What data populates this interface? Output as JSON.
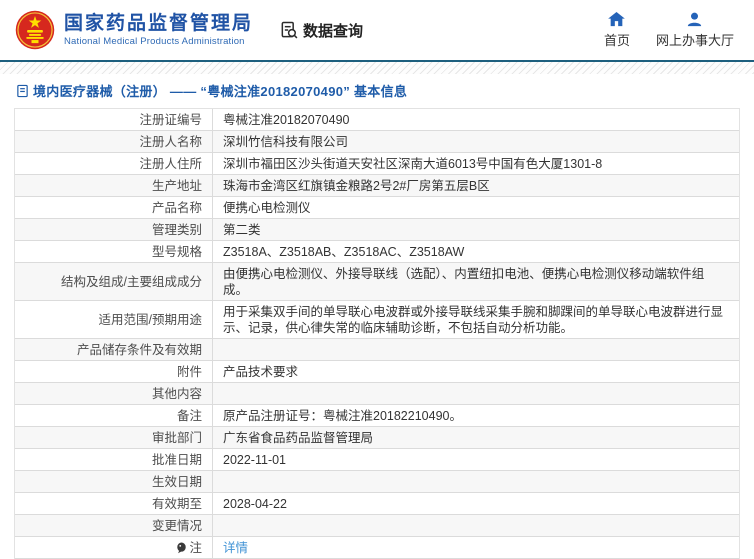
{
  "header": {
    "agency_name_zh": "国家药品监督管理局",
    "agency_name_en": "National Medical Products Administration",
    "nav_data_query": "数据查询",
    "nav_home": "首页",
    "nav_service_hall": "网上办事大厅"
  },
  "breadcrumb": {
    "title": "境内医疗器械（注册） —— “粤械注准20182070490” 基本信息"
  },
  "table": {
    "rows": [
      {
        "label": "注册证编号",
        "value": "粤械注准20182070490"
      },
      {
        "label": "注册人名称",
        "value": "深圳竹信科技有限公司"
      },
      {
        "label": "注册人住所",
        "value": "深圳市福田区沙头街道天安社区深南大道6013号中国有色大厦1301-8"
      },
      {
        "label": "生产地址",
        "value": "珠海市金湾区红旗镇金粮路2号2#厂房第五层B区"
      },
      {
        "label": "产品名称",
        "value": "便携心电检测仪"
      },
      {
        "label": "管理类别",
        "value": "第二类"
      },
      {
        "label": "型号规格",
        "value": "Z3518A、Z3518AB、Z3518AC、Z3518AW"
      },
      {
        "label": "结构及组成/主要组成成分",
        "value": "由便携心电检测仪、外接导联线（选配）、内置纽扣电池、便携心电检测仪移动端软件组成。"
      },
      {
        "label": "适用范围/预期用途",
        "value": "用于采集双手间的单导联心电波群或外接导联线采集手腕和脚踝间的单导联心电波群进行显示、记录，供心律失常的临床辅助诊断，不包括自动分析功能。"
      },
      {
        "label": "产品储存条件及有效期",
        "value": ""
      },
      {
        "label": "附件",
        "value": "产品技术要求"
      },
      {
        "label": "其他内容",
        "value": ""
      },
      {
        "label": "备注",
        "value": "原产品注册证号：粤械注准20182210490。"
      },
      {
        "label": "审批部门",
        "value": "广东省食品药品监督管理局"
      },
      {
        "label": "批准日期",
        "value": "2022-11-01"
      },
      {
        "label": "生效日期",
        "value": ""
      },
      {
        "label": "有效期至",
        "value": "2028-04-22"
      },
      {
        "label": "变更情况",
        "value": ""
      },
      {
        "label": "注",
        "value": "详情",
        "is_link": true,
        "has_note_icon": true
      }
    ]
  },
  "icons": {
    "emblem": "china-national-emblem",
    "data_query": "document-magnifier",
    "home": "house",
    "service_hall": "person",
    "breadcrumb": "document-sheet",
    "note": "speech-balloon"
  },
  "colors": {
    "agency_blue": "#2053a5",
    "divider_navy": "#1d5f7e",
    "breadcrumb_blue": "#1f5ca9",
    "link_blue": "#4193d5",
    "row_alt_gray": "#f7f7f7",
    "border_gray": "#dbdbdb",
    "emblem_red": "#d6281e",
    "emblem_gold": "#ffde00",
    "nav_icon_blue": "#2563b8"
  }
}
